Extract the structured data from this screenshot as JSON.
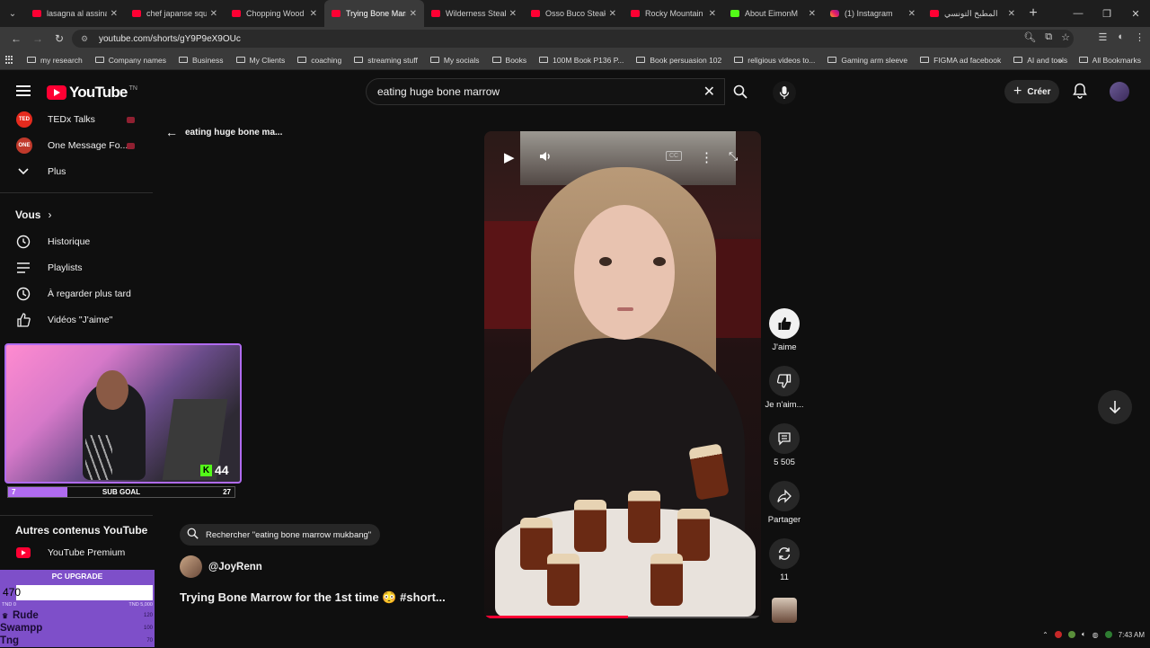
{
  "browser": {
    "tabs": [
      {
        "title": "lasagna al assina",
        "favicon": "youtube-icon"
      },
      {
        "title": "chef japanse squ",
        "favicon": "youtube-icon"
      },
      {
        "title": "Chopping Wood",
        "favicon": "youtube-icon"
      },
      {
        "title": "Trying Bone Marr",
        "favicon": "youtube-icon",
        "active": true
      },
      {
        "title": "Wilderness Steak",
        "favicon": "youtube-icon"
      },
      {
        "title": "Osso Buco Steak",
        "favicon": "youtube-icon"
      },
      {
        "title": "Rocky Mountain",
        "favicon": "youtube-icon"
      },
      {
        "title": "About EimonM",
        "favicon": "kick-icon"
      },
      {
        "title": "(1) Instagram",
        "favicon": "instagram-icon"
      },
      {
        "title": "المطبخ التونسي",
        "favicon": "youtube-icon"
      }
    ],
    "url": "youtube.com/shorts/gY9P9eX9OUc",
    "bookmarks": [
      "my research",
      "Company names",
      "Business",
      "My Clients",
      "coaching",
      "streaming stuff",
      "My socials",
      "Books",
      "100M Book P136 P...",
      "Book persuasion 102",
      "religious videos to...",
      "Gaming arm sleeve",
      "FIGMA ad facebook",
      "AI and tools"
    ],
    "all_bookmarks": "All Bookmarks"
  },
  "youtube": {
    "logo_text": "YouTube",
    "logo_country": "TN",
    "search_query": "eating huge bone marrow",
    "create_label": "Créer",
    "back_label": "eating huge bone ma...",
    "sidebar": {
      "channels": [
        {
          "label": "TEDx Talks",
          "badge": "TED",
          "color": "#e62b1e"
        },
        {
          "label": "One Message Fo...",
          "badge": "ONE",
          "color": "#c0392b"
        }
      ],
      "more_label": "Plus",
      "you_title": "Vous",
      "you_items": [
        {
          "label": "Historique",
          "icon": "history-icon"
        },
        {
          "label": "Playlists",
          "icon": "playlist-icon"
        },
        {
          "label": "À regarder plus tard",
          "icon": "clock-icon"
        },
        {
          "label": "Vidéos \"J'aime\"",
          "icon": "thumbs-up-icon"
        }
      ],
      "more_from_title": "Autres contenus YouTube",
      "premium_label": "YouTube Premium"
    },
    "short": {
      "suggest_search": "Rechercher \"eating bone marrow mukbang\"",
      "channel": "@JoyRenn",
      "title": "Trying Bone Marrow for the 1st time 😳 #short...",
      "progress": 0.52,
      "actions": {
        "like": "J'aime",
        "dislike": "Je n'aim...",
        "comments": "5 505",
        "share": "Partager",
        "remix": "11"
      }
    }
  },
  "overlay": {
    "kick_count": "44",
    "sub_goal": {
      "label": "SUB GOAL",
      "current": "7",
      "target": "27",
      "progress": 0.26
    },
    "pc_upgrade": {
      "title": "PC UPGRADE",
      "value": "470",
      "progress": 0.094,
      "range_low": "TND 0",
      "range_high": "TND 5,000",
      "items": [
        {
          "name": "Rude",
          "value": "120"
        },
        {
          "name": "Swampp",
          "value": "100"
        },
        {
          "name": "Tng",
          "value": "70"
        }
      ]
    }
  },
  "taskbar": {
    "time": "7:43 AM"
  },
  "colors": {
    "yt_red": "#ff0033",
    "kick_green": "#53fc18",
    "overlay_purple": "#7e4fc9"
  }
}
